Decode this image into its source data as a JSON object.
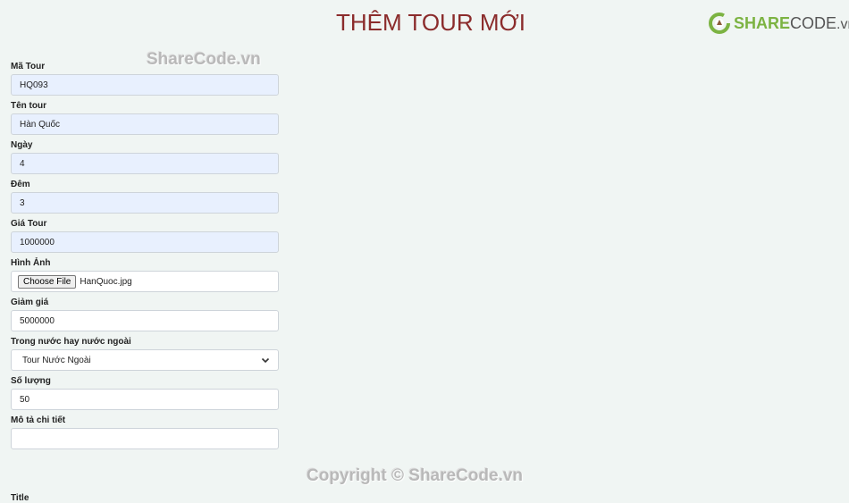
{
  "header": {
    "title": "THÊM TOUR MỚI",
    "logo": {
      "brand_part1": "SHARE",
      "brand_part2": "CODE",
      "brand_suffix": ".vn",
      "icon": "sharecode-logo-icon"
    }
  },
  "watermarks": {
    "top": "ShareCode.vn",
    "bottom": "Copyright © ShareCode.vn"
  },
  "form": {
    "fields": [
      {
        "label": "Mã Tour",
        "value": "HQ093",
        "type": "text",
        "autofilled": true
      },
      {
        "label": "Tên tour",
        "value": "Hàn Quốc",
        "type": "text",
        "autofilled": true
      },
      {
        "label": "Ngày",
        "value": "4",
        "type": "text",
        "autofilled": true
      },
      {
        "label": "Đêm",
        "value": "3",
        "type": "text",
        "autofilled": true
      },
      {
        "label": "Giá Tour",
        "value": "1000000",
        "type": "text",
        "autofilled": true
      },
      {
        "label": "Hình Ảnh",
        "type": "file",
        "button_label": "Choose File",
        "file_name": "HanQuoc.jpg"
      },
      {
        "label": "Giảm giá",
        "value": "5000000",
        "type": "text"
      },
      {
        "label": "Trong nước hay nước ngoài",
        "type": "select",
        "selected": "Tour Nước Ngoài"
      },
      {
        "label": "Số lượng",
        "value": "50",
        "type": "text"
      },
      {
        "label": "Mô tả chi tiết",
        "value": "",
        "type": "text"
      }
    ],
    "next_label": "Title"
  }
}
